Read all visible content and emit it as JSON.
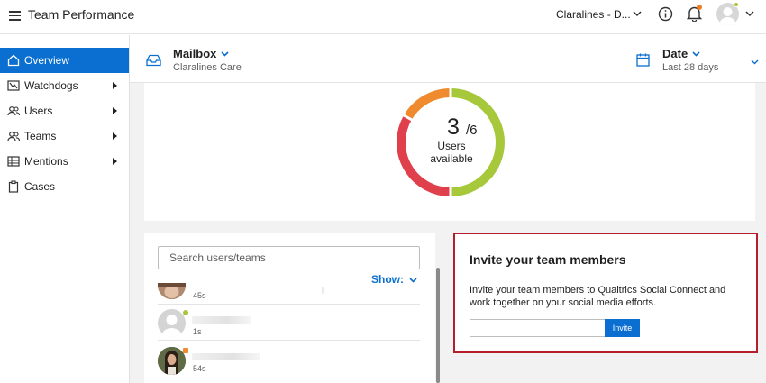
{
  "app": {
    "title": "Team Performance"
  },
  "topbar": {
    "brand": "Claralines - D...",
    "icons": [
      "menu-icon",
      "chevron-down-icon",
      "info-icon",
      "bell-icon",
      "avatar",
      "chevron-down-icon"
    ],
    "accent": "#0b6fd1"
  },
  "sidebar": {
    "items": [
      {
        "label": "Overview",
        "icon": "home-icon",
        "active": true,
        "has_submenu": false
      },
      {
        "label": "Watchdogs",
        "icon": "watchdog-icon",
        "active": false,
        "has_submenu": true
      },
      {
        "label": "Users",
        "icon": "users-icon",
        "active": false,
        "has_submenu": true
      },
      {
        "label": "Teams",
        "icon": "teams-icon",
        "active": false,
        "has_submenu": true
      },
      {
        "label": "Mentions",
        "icon": "mentions-icon",
        "active": false,
        "has_submenu": true
      },
      {
        "label": "Cases",
        "icon": "clipboard-icon",
        "active": false,
        "has_submenu": false
      }
    ]
  },
  "header": {
    "mailbox": {
      "label": "Mailbox",
      "value": "Claralines Care"
    },
    "date": {
      "label": "Date",
      "value": "Last 28 days"
    }
  },
  "availability": {
    "available": "3",
    "total": "/6",
    "caption": "Users available",
    "colors": {
      "available": "#a7c83a",
      "away": "#ef8a2e",
      "offline": "#e0404b"
    }
  },
  "users_panel": {
    "search_placeholder": "Search users/teams",
    "show_label": "Show:",
    "rows": [
      {
        "time": "45s",
        "status": ""
      },
      {
        "time": "1s",
        "status": "#a7c83a"
      },
      {
        "time": "54s",
        "status": "#ef8a2e"
      }
    ]
  },
  "invite": {
    "title": "Invite your team members",
    "description": "Invite your team members to Qualtrics Social Connect and work together on your social media efforts.",
    "input_value": "",
    "button_label": "Invite",
    "border_color": "#b51e2b"
  }
}
